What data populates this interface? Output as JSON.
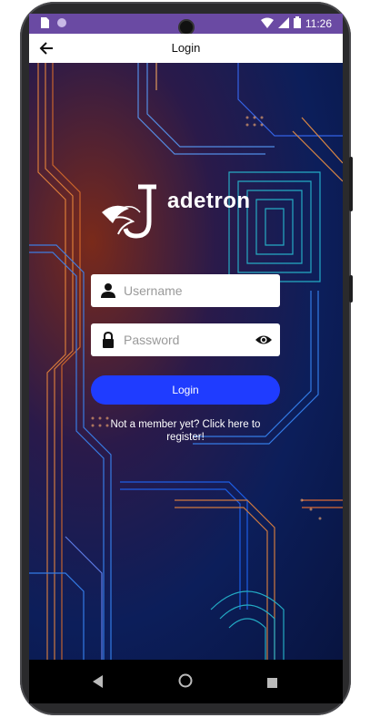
{
  "status_bar": {
    "time": "11:26"
  },
  "app_bar": {
    "title": "Login"
  },
  "brand": {
    "logo_text": "adetron",
    "logo_initial": "J"
  },
  "form": {
    "username_placeholder": "Username",
    "username_value": "",
    "password_placeholder": "Password",
    "password_value": "",
    "login_label": "Login",
    "register_text": "Not a member yet? Click here to register!"
  },
  "colors": {
    "status_bar": "#6a4aa3",
    "primary_button": "#1f3cff",
    "app_bar": "#ffffff"
  },
  "icons": {
    "back": "arrow-left-icon",
    "user": "person-icon",
    "lock": "lock-icon",
    "eye": "eye-icon"
  }
}
